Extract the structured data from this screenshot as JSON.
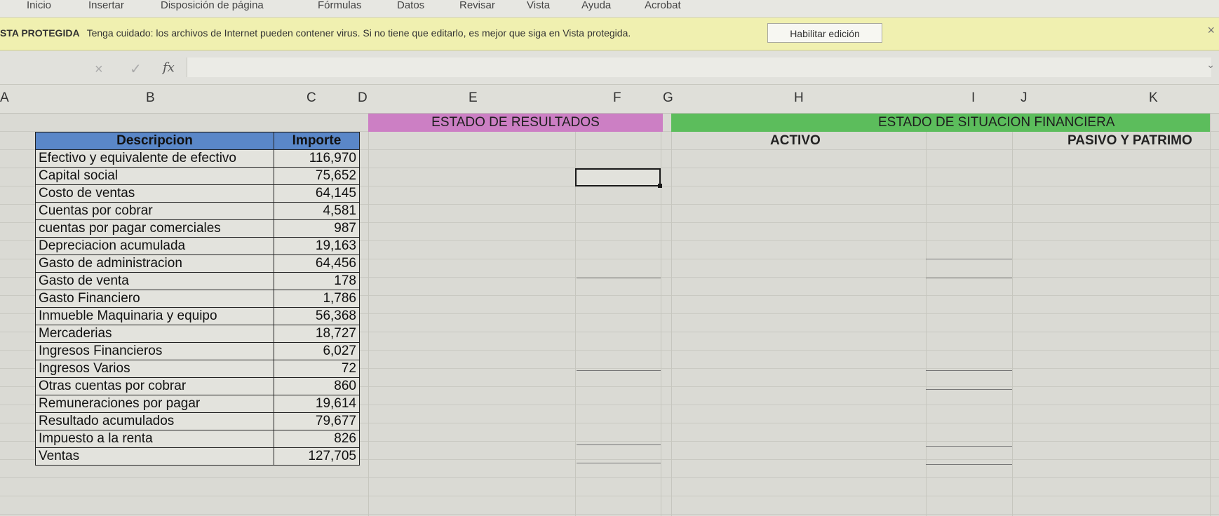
{
  "ribbon": {
    "tabs": [
      "Inicio",
      "Insertar",
      "Disposición de página",
      "Fórmulas",
      "Datos",
      "Revisar",
      "Vista",
      "Ayuda",
      "Acrobat"
    ]
  },
  "protected_view": {
    "title": "STA PROTEGIDA",
    "message": "Tenga cuidado: los archivos de Internet pueden contener virus. Si no tiene que editarlo, es mejor que siga en Vista protegida.",
    "button": "Habilitar edición",
    "close": "×"
  },
  "formula_bar": {
    "fx": "fx",
    "cancel": "×",
    "enter": "✓"
  },
  "columns": [
    "A",
    "B",
    "C",
    "D",
    "E",
    "F",
    "G",
    "H",
    "I",
    "J",
    "K"
  ],
  "sheet": {
    "estado_resultados": "ESTADO DE RESULTADOS",
    "estado_situacion": "ESTADO DE SITUACION FINANCIERA",
    "activo": "ACTIVO",
    "pasivo": "PASIVO Y PATRIMO"
  },
  "table": {
    "headers": {
      "desc": "Descripcion",
      "amount": "Importe"
    },
    "rows": [
      {
        "desc": "Efectivo y equivalente de efectivo",
        "amount": "116,970"
      },
      {
        "desc": "Capital social",
        "amount": "75,652"
      },
      {
        "desc": "Costo de ventas",
        "amount": "64,145"
      },
      {
        "desc": "Cuentas por cobrar",
        "amount": "4,581"
      },
      {
        "desc": "cuentas por pagar comerciales",
        "amount": "987"
      },
      {
        "desc": "Depreciacion acumulada",
        "amount": "19,163"
      },
      {
        "desc": "Gasto de administracion",
        "amount": "64,456"
      },
      {
        "desc": "Gasto de venta",
        "amount": "178"
      },
      {
        "desc": "Gasto Financiero",
        "amount": "1,786"
      },
      {
        "desc": "Inmueble Maquinaria y equipo",
        "amount": "56,368"
      },
      {
        "desc": "Mercaderias",
        "amount": "18,727"
      },
      {
        "desc": "Ingresos Financieros",
        "amount": "6,027"
      },
      {
        "desc": "Ingresos Varios",
        "amount": "72"
      },
      {
        "desc": "Otras cuentas por cobrar",
        "amount": "860"
      },
      {
        "desc": "Remuneraciones por pagar",
        "amount": "19,614"
      },
      {
        "desc": "Resultado acumulados",
        "amount": "79,677"
      },
      {
        "desc": "Impuesto a la renta",
        "amount": "826"
      },
      {
        "desc": "Ventas",
        "amount": "127,705"
      }
    ]
  },
  "colors": {
    "pink_banner": "#cc7fc4",
    "green_banner": "#5cbd5c",
    "table_header": "#5a87c8",
    "protected_bar": "#f0f0b0"
  }
}
